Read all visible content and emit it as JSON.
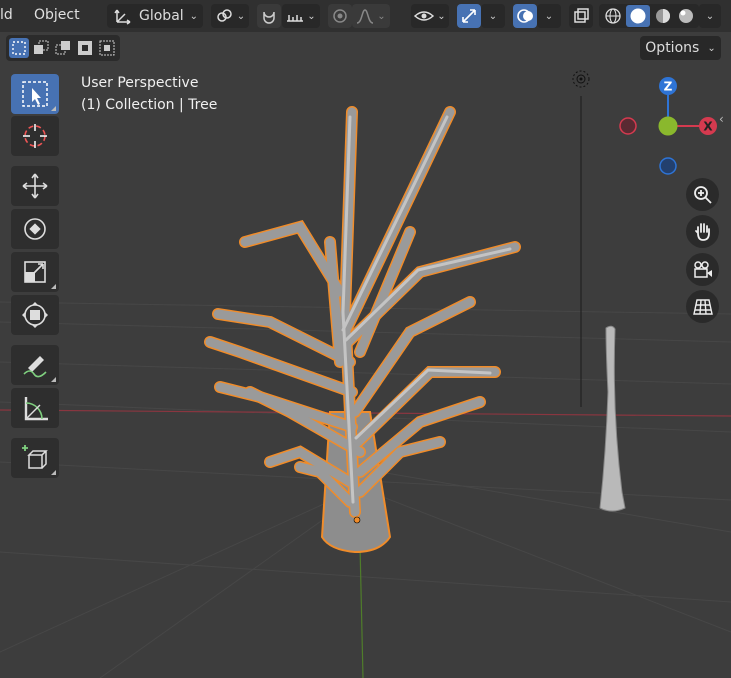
{
  "menu": {
    "item_partial": "ld",
    "object": "Object"
  },
  "header": {
    "orientation": "Global",
    "options_label": "Options"
  },
  "viewport": {
    "view_name": "User Perspective",
    "collection_label": "(1) Collection | Tree"
  },
  "gizmo": {
    "z_label": "Z",
    "x_label": "X"
  },
  "colors": {
    "accent": "#4772b3",
    "selection_outline": "#f08c2a",
    "axis_x": "#d53a4f",
    "axis_y": "#8ab82d",
    "axis_z": "#2e74d6"
  },
  "tools": [
    "select-box",
    "cursor",
    "move",
    "rotate",
    "scale",
    "transform",
    "annotate",
    "measure",
    "add-cube"
  ],
  "nav_icons": [
    "zoom-icon",
    "hand-icon",
    "camera-icon",
    "grid-icon"
  ]
}
